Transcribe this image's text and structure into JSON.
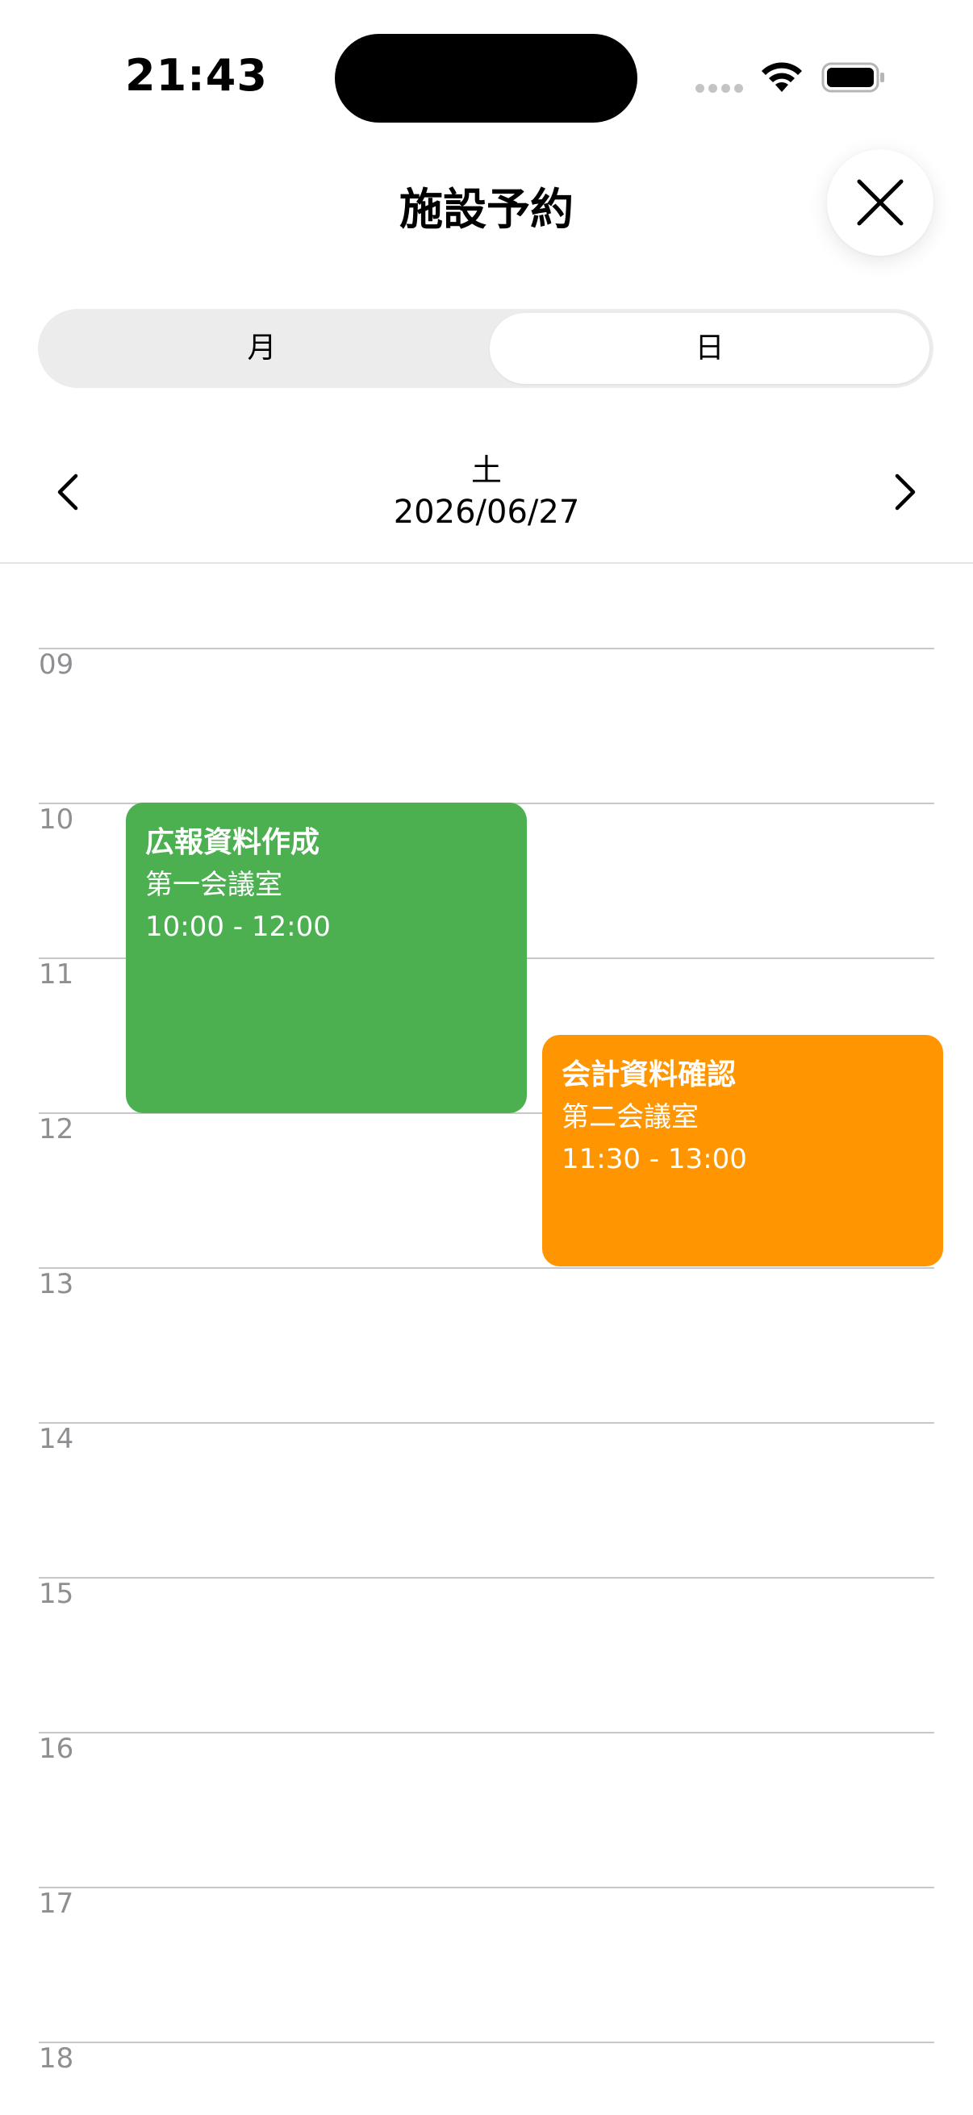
{
  "status_bar": {
    "time": "21:43"
  },
  "header": {
    "title": "施設予約",
    "close_icon": "close-icon"
  },
  "view_toggle": {
    "options": [
      "月",
      "日"
    ],
    "selected": "日"
  },
  "date_nav": {
    "weekday": "土",
    "date": "2026/06/27"
  },
  "timeline": {
    "hours": [
      "09",
      "10",
      "11",
      "12",
      "13",
      "14",
      "15",
      "16",
      "17",
      "18"
    ],
    "events": [
      {
        "title": "広報資料作成",
        "room": "第一会議室",
        "time": "10:00 - 12:00",
        "color": "#4caf50"
      },
      {
        "title": "会計資料確認",
        "room": "第二会議室",
        "time": "11:30 - 13:00",
        "color": "#ff9500"
      }
    ]
  }
}
